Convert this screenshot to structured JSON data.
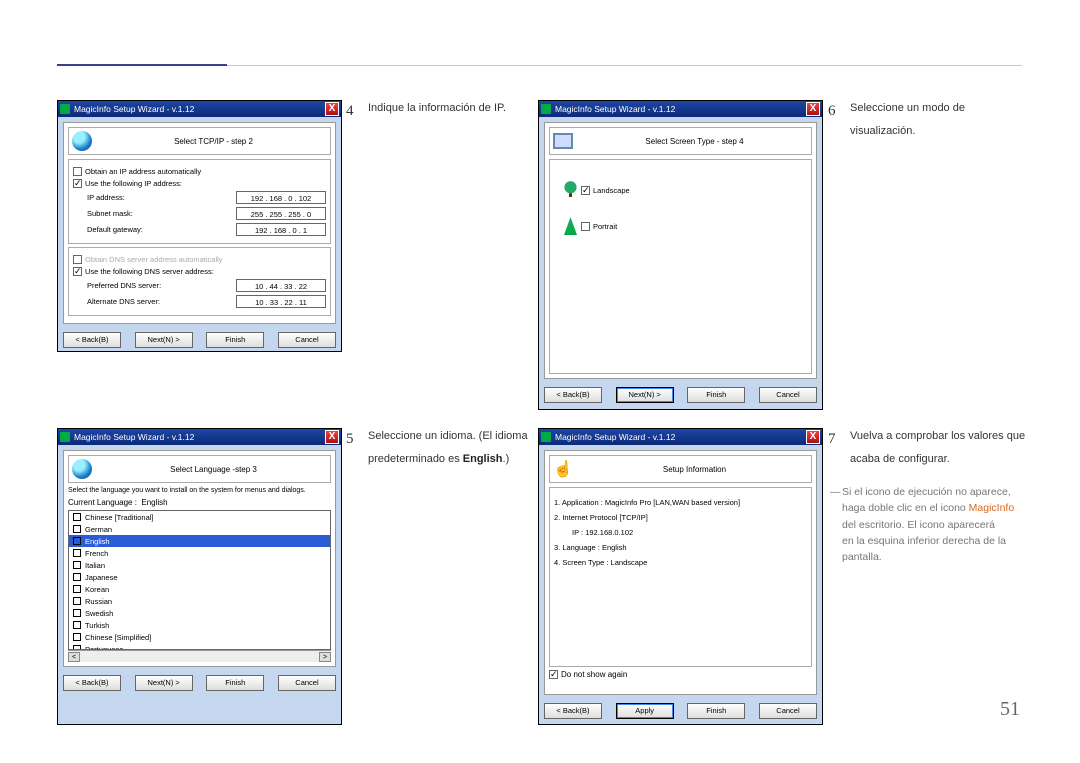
{
  "page_number": "51",
  "wizard_title": "MagicInfo Setup Wizard - v.1.12",
  "buttons": {
    "back": "< Back(B)",
    "next": "Next(N) >",
    "finish": "Finish",
    "cancel": "Cancel",
    "apply": "Apply"
  },
  "step2": {
    "header": "Select TCP/IP - step 2",
    "opt_auto": "Obtain an IP address automatically",
    "opt_manual": "Use the following IP address:",
    "ip_label": "IP address:",
    "ip": "192 . 168 .  0  . 102",
    "mask_label": "Subnet mask:",
    "mask": "255 . 255 . 255 .  0",
    "gw_label": "Default gateway:",
    "gw": "192 . 168 .  0  .  1",
    "dns_auto": "Obtain DNS server address automatically",
    "dns_manual": "Use the following DNS server address:",
    "dns1_label": "Preferred DNS server:",
    "dns1": "10 . 44 . 33 . 22",
    "dns2_label": "Alternate DNS server:",
    "dns2": "10 . 33 . 22 . 11"
  },
  "step3": {
    "header": "Select Language -step 3",
    "desc": "Select the language you want to install on the system for menus and dialogs.",
    "current_label": "Current Language   :",
    "current": "English",
    "languages": [
      "Chinese [Traditional]",
      "German",
      "English",
      "French",
      "Italian",
      "Japanese",
      "Korean",
      "Russian",
      "Swedish",
      "Turkish",
      "Chinese [Simplified]",
      "Portuguese"
    ],
    "selected_index": 2
  },
  "step4": {
    "header": "Select Screen Type - step 4",
    "landscape": "Landscape",
    "portrait": "Portrait"
  },
  "step5": {
    "header": "Setup Information",
    "l1": "1. Application    :    MagicInfo Pro [LAN,WAN based version]",
    "l2": "2. Internet Protocol [TCP/IP]",
    "l2b": "IP :    192.168.0.102",
    "l3": "3. Language  :    English",
    "l4": "4. Screen Type :    Landscape",
    "dontshow": "Do not show again"
  },
  "captions": {
    "c4": "Indique la información de IP.",
    "c5a": "Seleccione un idioma. (El idioma",
    "c5b": "predeterminado es ",
    "c5bold": "English",
    "c5c": ".)",
    "c6a": "Seleccione un modo de",
    "c6b": "visualización.",
    "c7a": "Vuelva a comprobar los valores que",
    "c7b": "acaba de configurar."
  },
  "note": {
    "l1": "Si el icono de ejecución no aparece,",
    "l2a": "haga doble clic en el icono ",
    "l2b": "MagicInfo",
    "l3": "del escritorio. El icono aparecerá",
    "l4": "en la esquina inferior derecha de la",
    "l5": "pantalla."
  },
  "nums": {
    "n4": "4",
    "n5": "5",
    "n6": "6",
    "n7": "7"
  }
}
